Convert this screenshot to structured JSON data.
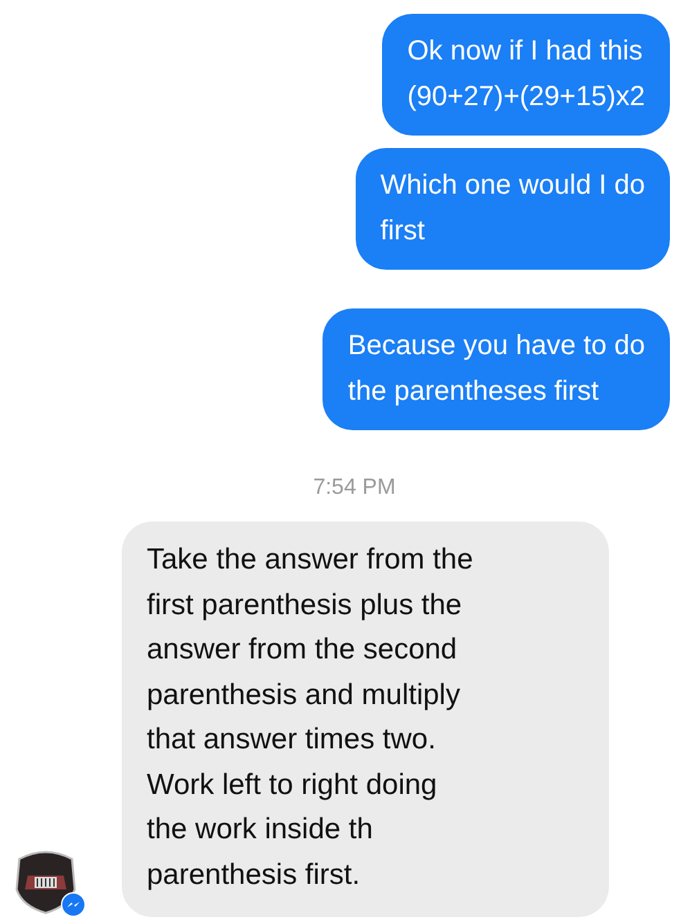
{
  "messages": [
    {
      "kind": "sent",
      "lines": [
        "Ok now if I had this",
        "(90+27)+(29+15)x2"
      ]
    },
    {
      "kind": "sent",
      "lines": [
        "Which one would I do",
        "first"
      ]
    },
    {
      "kind": "sent",
      "lines": [
        "Because you have to do",
        "the parentheses first"
      ]
    },
    {
      "kind": "time",
      "lines": [
        "7:54 PM"
      ]
    },
    {
      "kind": "received",
      "lines": [
        "Take the answer from the",
        "first parenthesis plus the",
        "answer from the second",
        "parenthesis and multiply",
        "that answer times two.",
        "Work left to right doing",
        "the work inside th",
        "parenthesis first."
      ]
    }
  ]
}
